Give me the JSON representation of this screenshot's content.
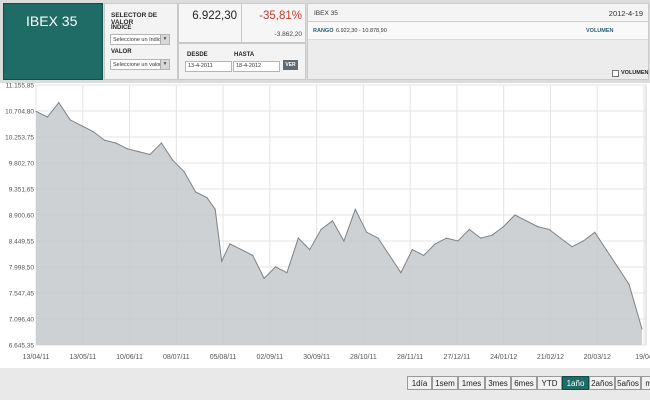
{
  "logo": {
    "text": "IBEX 35"
  },
  "selector": {
    "title": "SELECTOR DE VALOR",
    "index_label": "ÍNDICE",
    "index_placeholder": "Seleccione un índice",
    "value_label": "VALOR",
    "value_placeholder": "Seleccione un valor"
  },
  "quote": {
    "price": "6.922,30",
    "change_pct": "-35,81%",
    "change_abs": "-3.862,20"
  },
  "dates": {
    "from_label": "DESDE",
    "from_value": "13-4-2011",
    "to_label": "HASTA",
    "to_value": "18-4-2012",
    "go_label": "VER"
  },
  "info": {
    "name": "IBEX 35",
    "date": "2012-4-19",
    "range_label": "RANGO",
    "range_value": "6.922,30 - 10.878,90",
    "volume_label": "VOLUMEN",
    "volume_toggle_label": "VOLUMEN"
  },
  "range_buttons": [
    "1día",
    "1sem",
    "1mes",
    "3mes",
    "6mes",
    "YTD",
    "1año",
    "2años",
    "5años",
    "máx."
  ],
  "active_range": "1año",
  "colors": {
    "accent": "#1f6b66",
    "negative": "#c0392b",
    "area_fill": "#c5c9cc",
    "line": "#7d8286"
  },
  "chart_data": {
    "type": "area",
    "y_ticks": [
      "11.155,85",
      "10.704,80",
      "10.253,75",
      "9.802,70",
      "9.351,65",
      "8.900,60",
      "8.449,55",
      "7.998,50",
      "7.547,45",
      "7.096,40",
      "6.645,35"
    ],
    "x_ticks": [
      "13/04/11",
      "13/05/11",
      "10/06/11",
      "08/07/11",
      "05/08/11",
      "02/09/11",
      "30/09/11",
      "28/10/11",
      "28/11/11",
      "27/12/11",
      "24/01/12",
      "21/02/12",
      "20/03/12",
      "19/04"
    ],
    "ylim": [
      6645.35,
      11155.85
    ],
    "grid": true,
    "x": [
      "2011-04-13",
      "2011-04-20",
      "2011-04-27",
      "2011-05-04",
      "2011-05-11",
      "2011-05-18",
      "2011-05-25",
      "2011-06-01",
      "2011-06-08",
      "2011-06-15",
      "2011-06-22",
      "2011-06-29",
      "2011-07-06",
      "2011-07-13",
      "2011-07-20",
      "2011-07-27",
      "2011-08-01",
      "2011-08-05",
      "2011-08-10",
      "2011-08-17",
      "2011-08-24",
      "2011-08-31",
      "2011-09-07",
      "2011-09-14",
      "2011-09-21",
      "2011-09-28",
      "2011-10-05",
      "2011-10-12",
      "2011-10-19",
      "2011-10-26",
      "2011-11-02",
      "2011-11-09",
      "2011-11-16",
      "2011-11-23",
      "2011-11-30",
      "2011-12-07",
      "2011-12-14",
      "2011-12-21",
      "2011-12-28",
      "2012-01-04",
      "2012-01-11",
      "2012-01-18",
      "2012-01-25",
      "2012-02-01",
      "2012-02-08",
      "2012-02-15",
      "2012-02-22",
      "2012-02-29",
      "2012-03-07",
      "2012-03-14",
      "2012-03-21",
      "2012-03-28",
      "2012-04-04",
      "2012-04-11",
      "2012-04-19"
    ],
    "series": [
      {
        "values": [
          10700,
          10600,
          10850,
          10550,
          10450,
          10350,
          10200,
          10150,
          10050,
          10000,
          9950,
          10150,
          9850,
          9650,
          9300,
          9200,
          9000,
          8100,
          8400,
          8300,
          8200,
          7800,
          8000,
          7900,
          8500,
          8300,
          8650,
          8800,
          8450,
          9000,
          8600,
          8500,
          8200,
          7900,
          8300,
          8200,
          8400,
          8500,
          8450,
          8650,
          8500,
          8550,
          8700,
          8900,
          8800,
          8700,
          8650,
          8500,
          8350,
          8450,
          8600,
          8300,
          8000,
          7700,
          6923
        ]
      }
    ]
  }
}
